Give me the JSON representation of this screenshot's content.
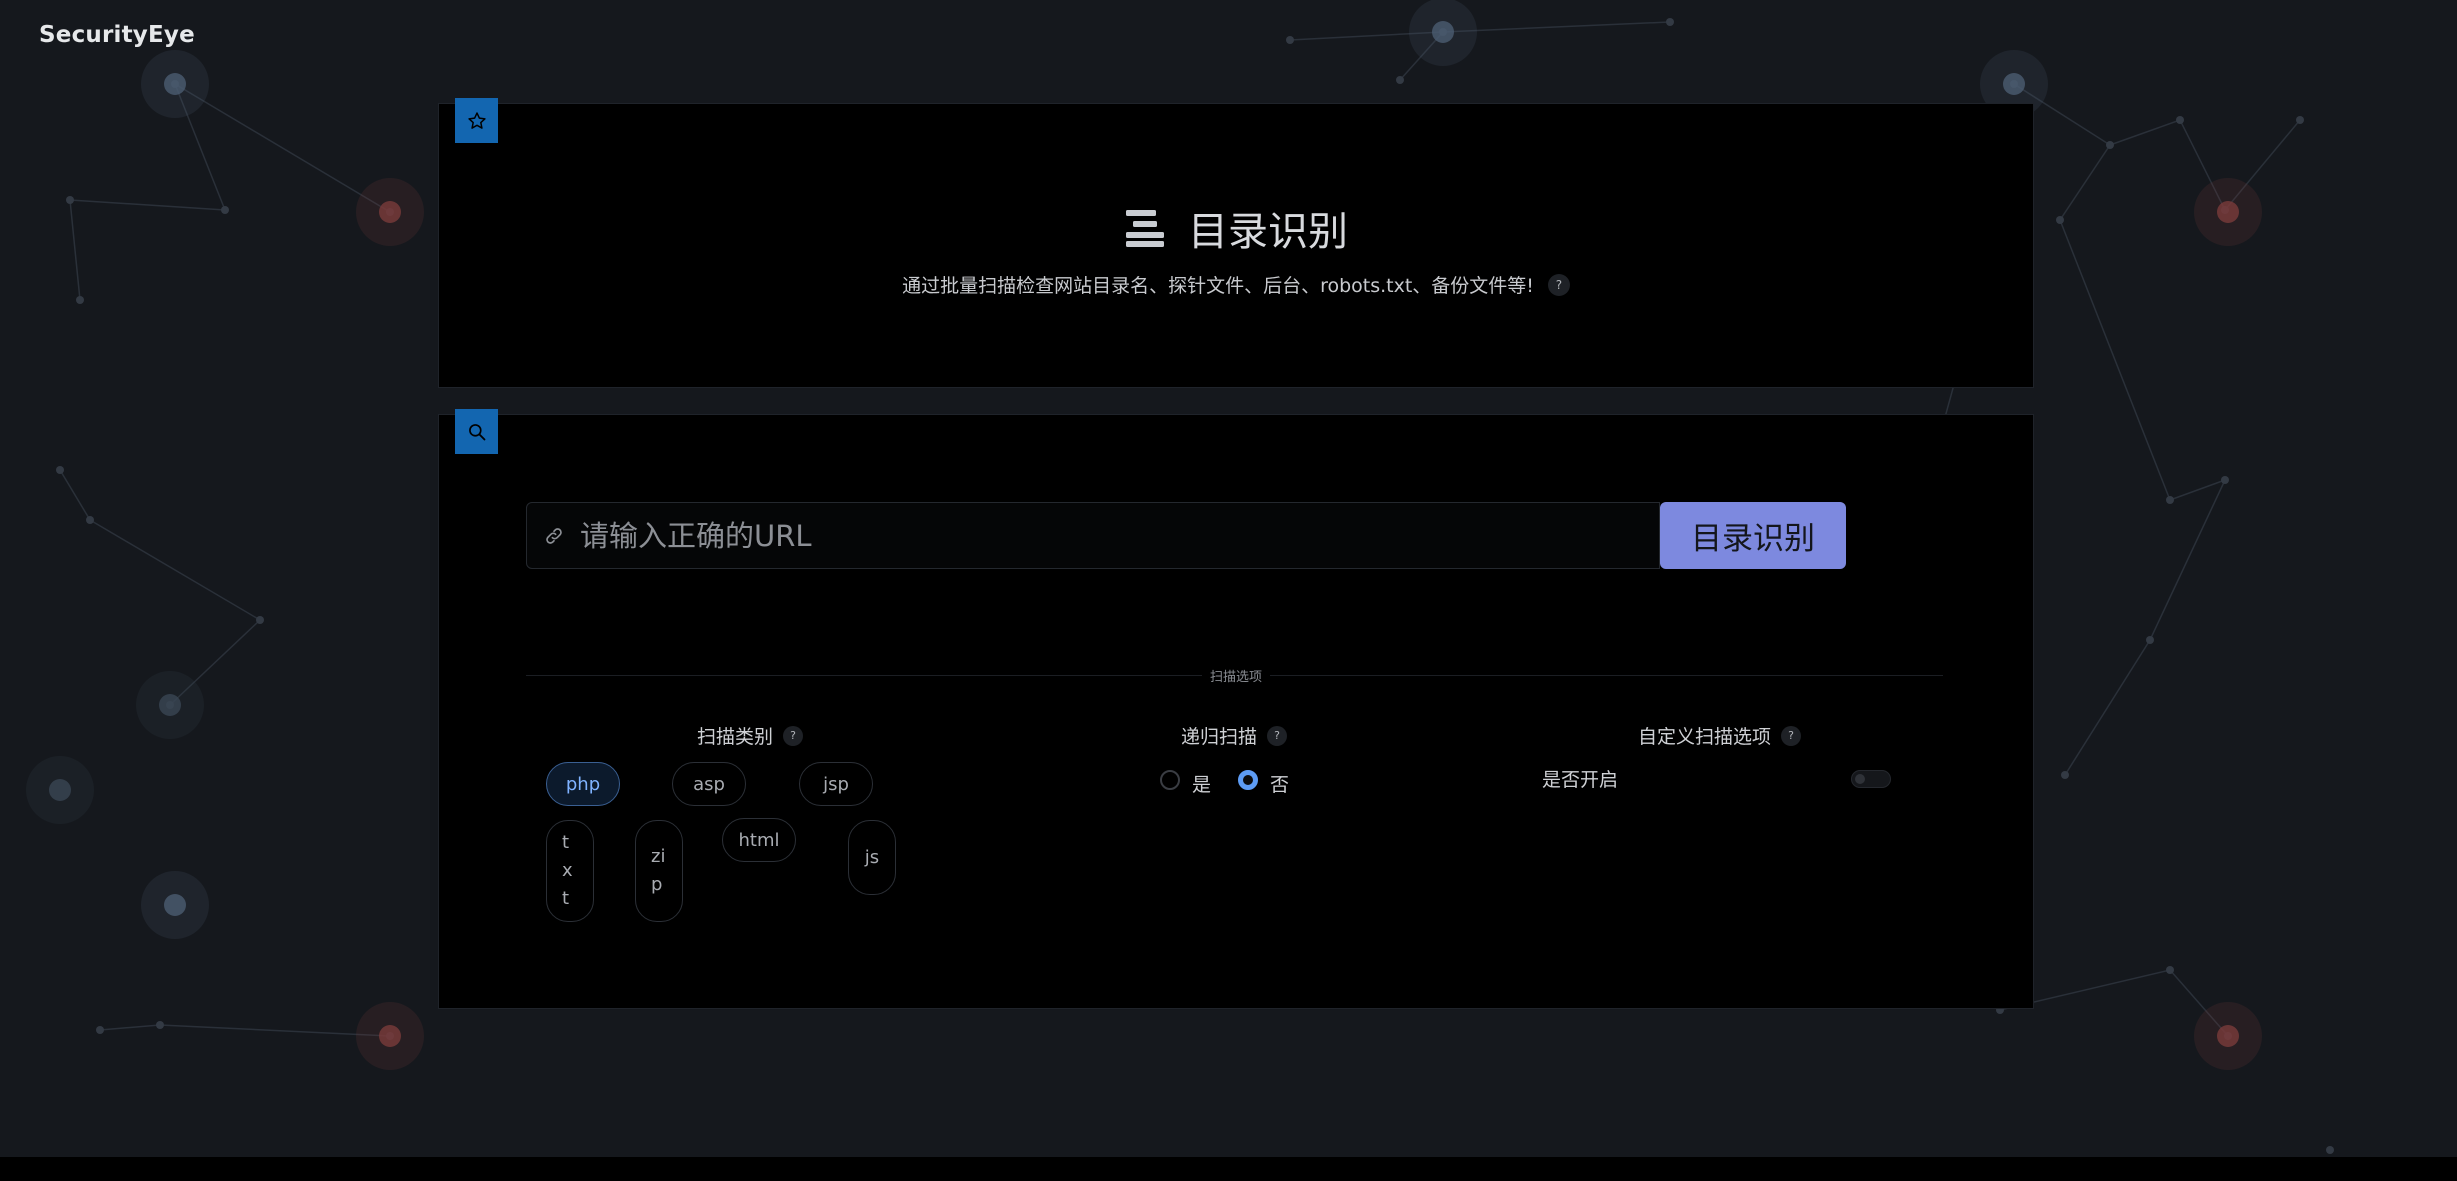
{
  "brand": {
    "name": "SecurityEye"
  },
  "header_card": {
    "badge_icon": "star-icon",
    "title_icon": "list-icon",
    "title": "目录识别",
    "subtitle": "通过批量扫描检查网站目录名、探针文件、后台、robots.txt、备份文件等!",
    "help": "?"
  },
  "form_card": {
    "badge_icon": "search-icon",
    "url_input": {
      "placeholder": "请输入正确的URL",
      "value": "",
      "icon": "link-icon"
    },
    "submit_label": "目录识别",
    "options_divider_label": "扫描选项",
    "scan_type": {
      "title": "扫描类别",
      "help": "?",
      "chips": [
        "php",
        "asp",
        "jsp",
        "txt",
        "zip",
        "html",
        "js"
      ],
      "selected": "php"
    },
    "recursive": {
      "title": "递归扫描",
      "help": "?",
      "options": [
        "是",
        "否"
      ],
      "selected": "否"
    },
    "custom": {
      "title": "自定义扫描选项",
      "help": "?",
      "toggle_label": "是否开启",
      "enabled": false
    }
  },
  "colors": {
    "background": "#15181d",
    "card": "#000000",
    "badge": "#1366b0",
    "accent_button": "#7d89df",
    "active_chip": "#7fb2ff",
    "radio_checked": "#5d9cf5"
  }
}
